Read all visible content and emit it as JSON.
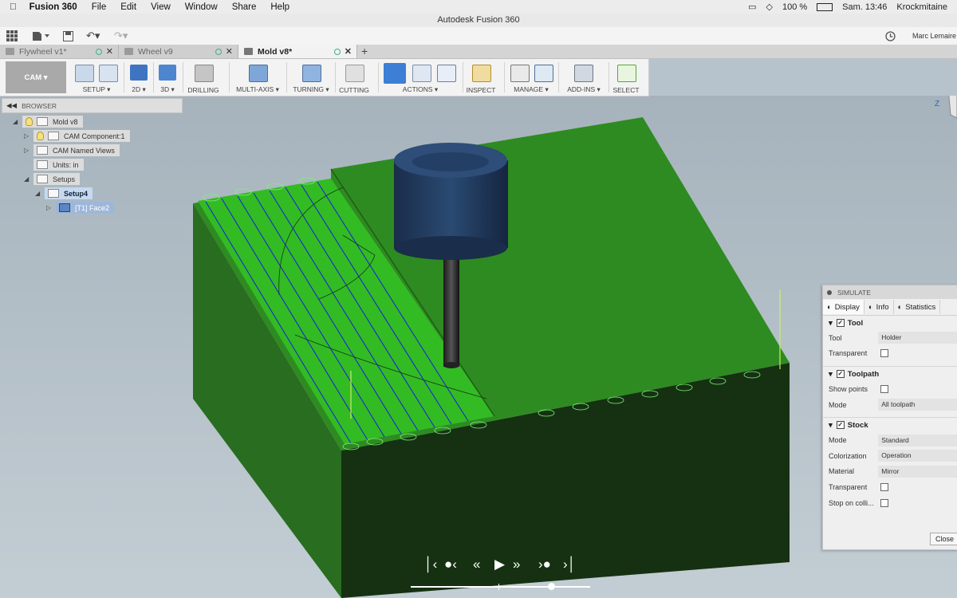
{
  "menubar": {
    "app_name": "Fusion 360",
    "items": [
      "File",
      "Edit",
      "View",
      "Window",
      "Share",
      "Help"
    ],
    "battery": "100 %",
    "clock": "Sam. 13:46",
    "user": "Krockmitaine"
  },
  "window_title": "Autodesk Fusion 360",
  "account_name": "Marc Lemaire",
  "tabs": [
    {
      "label": "Flywheel v1*"
    },
    {
      "label": "Wheel v9"
    },
    {
      "label": "Mold v8*"
    }
  ],
  "workspace": "CAM",
  "toolbar_groups": [
    {
      "label": "SETUP"
    },
    {
      "label": "2D"
    },
    {
      "label": "3D"
    },
    {
      "label": "DRILLING"
    },
    {
      "label": "MULTI-AXIS"
    },
    {
      "label": "TURNING"
    },
    {
      "label": "CUTTING"
    },
    {
      "label": "ACTIONS"
    },
    {
      "label": "INSPECT"
    },
    {
      "label": "MANAGE"
    },
    {
      "label": "ADD-INS"
    },
    {
      "label": "SELECT"
    }
  ],
  "browser": {
    "title": "BROWSER",
    "nodes": [
      {
        "label": "Mold v8"
      },
      {
        "label": "CAM Component:1"
      },
      {
        "label": "CAM Named Views"
      },
      {
        "label": "Units: in"
      },
      {
        "label": "Setups"
      },
      {
        "label": "Setup4"
      },
      {
        "label": "[T1] Face2"
      }
    ]
  },
  "viewcube_axis": "Z",
  "simulate": {
    "title": "SIMULATE",
    "tabs": [
      "Display",
      "Info",
      "Statistics"
    ],
    "sections": {
      "tool": {
        "title": "Tool",
        "rows": [
          {
            "label": "Tool",
            "value": "Holder"
          },
          {
            "label": "Transparent"
          }
        ]
      },
      "toolpath": {
        "title": "Toolpath",
        "rows": [
          {
            "label": "Show points"
          },
          {
            "label": "Mode",
            "value": "All toolpath"
          }
        ]
      },
      "stock": {
        "title": "Stock",
        "rows": [
          {
            "label": "Mode",
            "value": "Standard"
          },
          {
            "label": "Colorization",
            "value": "Operation"
          },
          {
            "label": "Material",
            "value": "Mirror"
          },
          {
            "label": "Transparent"
          },
          {
            "label": "Stop on colli..."
          }
        ]
      }
    },
    "close_label": "Close"
  },
  "playback": {
    "progress": 0.78
  },
  "colors": {
    "model_green": "#2e8b21",
    "machined_face": "#33bb24",
    "tool_body": "#1f3656",
    "toolpath_blue": "#1b2ad0",
    "viewport_bg": "#b7c3cc"
  }
}
